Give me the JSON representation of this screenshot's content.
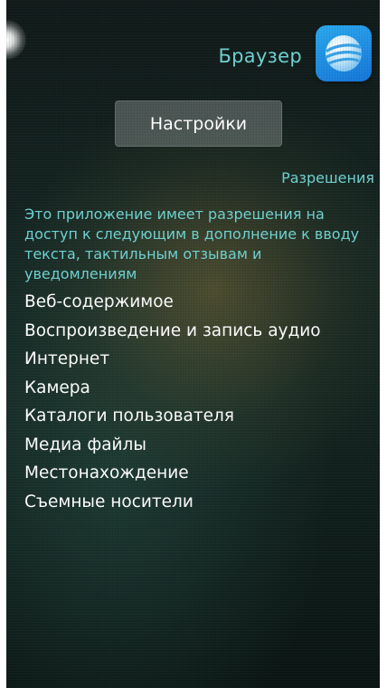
{
  "header": {
    "app_name": "Браузер",
    "app_icon": "browser-sphere-icon"
  },
  "settings_button": {
    "label": "Настройки"
  },
  "permissions": {
    "title": "Разрешения",
    "description": "Это приложение имеет разрешения на доступ к следующим в дополнение к вводу текста, тактильным отзывам и уведомлениям",
    "items": [
      "Веб-содержимое",
      "Воспроизведение и запись аудио",
      "Интернет",
      "Камера",
      "Каталоги пользователя",
      "Медиа файлы",
      "Местонахождение",
      "Съемные носители"
    ]
  },
  "colors": {
    "accent": "#6fd3d2",
    "text": "#ffffff",
    "background": "#132320",
    "icon": "#1e8fe6"
  }
}
